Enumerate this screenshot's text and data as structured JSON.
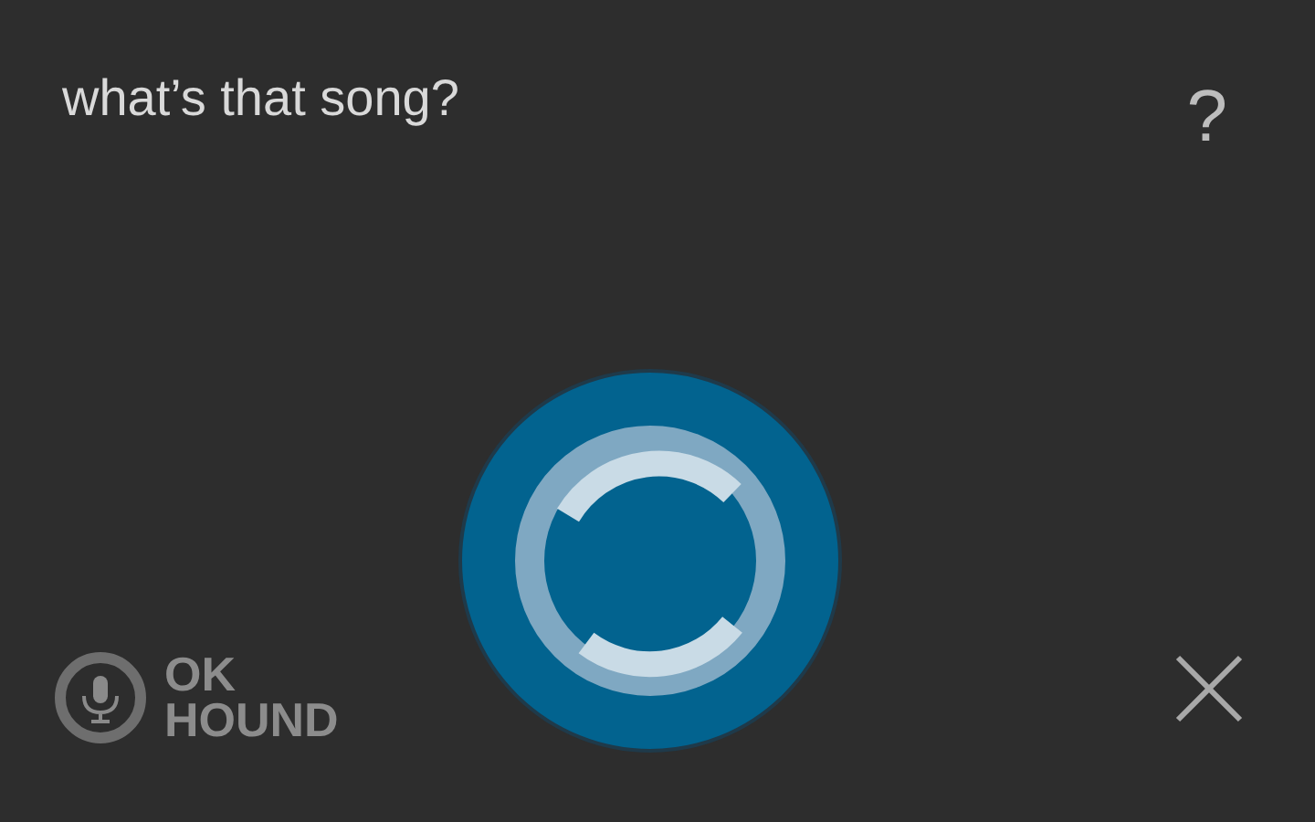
{
  "prompt": "what’s that song?",
  "help": "?",
  "wake_word": {
    "line_1": "OK",
    "line_2": "HOUND"
  }
}
